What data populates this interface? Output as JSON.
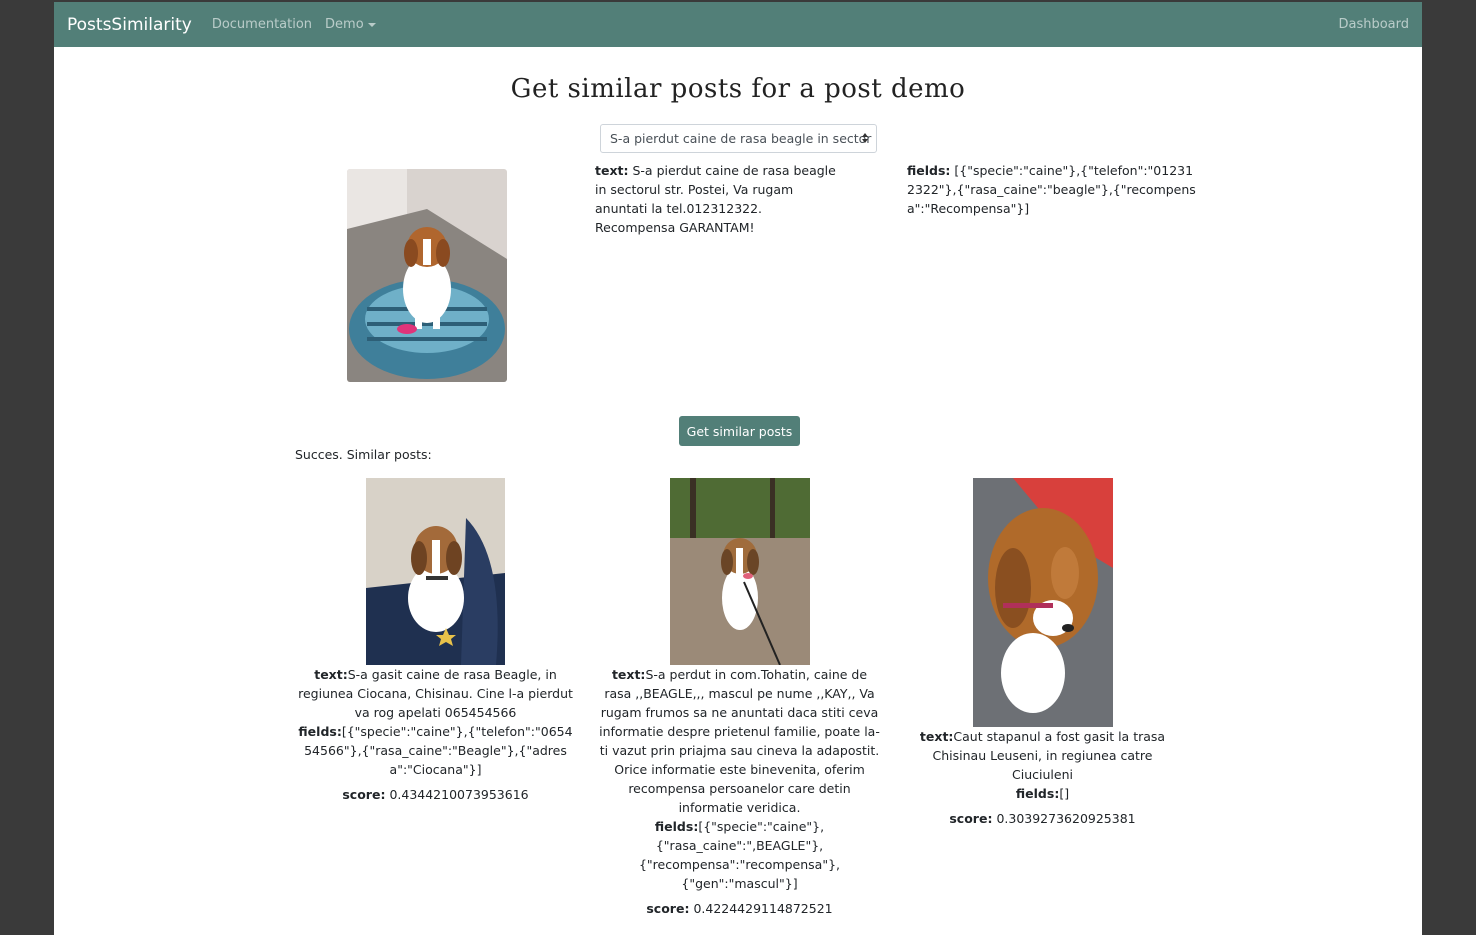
{
  "navbar": {
    "brand": "PostsSimilarity",
    "links": [
      "Documentation",
      "Demo"
    ],
    "right_link": "Dashboard"
  },
  "title": "Get similar posts for a post demo",
  "select": {
    "value": "S-a pierdut caine de rasa beagle in sector"
  },
  "query_post": {
    "text_label": "text:",
    "text": "S-a pierdut caine de rasa beagle in sectorul str. Postei, Va rugam anuntati la tel.012312322. Recompensa GARANTAM!",
    "fields_label": "fields:",
    "fields": "[{\"specie\":\"caine\"},{\"telefon\":\"012312322\"},{\"rasa_caine\":\"beagle\"},{\"recompensa\":\"Recompensa\"}]"
  },
  "button": "Get similar posts",
  "status": "Succes. Similar posts:",
  "results": [
    {
      "text_label": "text:",
      "text": "S-a gasit caine de rasa Beagle, in regiunea Ciocana, Chisinau. Cine l-a pierdut va rog apelati 065454566",
      "fields_label": "fields:",
      "fields": "[{\"specie\":\"caine\"},{\"telefon\":\"065454566\"},{\"rasa_caine\":\"Beagle\"},{\"adresa\":\"Ciocana\"}]",
      "score_label": "score:",
      "score": "0.4344210073953616"
    },
    {
      "text_label": "text:",
      "text": "S-a perdut in com.Tohatin, caine de rasa ,,BEAGLE,,, mascul pe nume ,,KAY,, Va rugam frumos sa ne anuntati daca stiti ceva informatie despre prietenul familie, poate la-ti vazut prin priajma sau cineva la adapostit. Orice informatie este binevenita, oferim recompensa persoanelor care detin informatie veridica.",
      "fields_label": "fields:",
      "fields": "[{\"specie\":\"caine\"},{\"rasa_caine\":\",BEAGLE\"},{\"recompensa\":\"recompensa\"},{\"gen\":\"mascul\"}]",
      "score_label": "score:",
      "score": "0.4224429114872521"
    },
    {
      "text_label": "text:",
      "text": "Caut stapanul a fost gasit la trasa Chisinau Leuseni, in regiunea catre Ciuciuleni",
      "fields_label": "fields:",
      "fields": "[]",
      "score_label": "score:",
      "score": "0.3039273620925381"
    }
  ],
  "colors": {
    "navbar": "#527f78",
    "button": "#527f78",
    "background_outer": "#3a3a3a"
  },
  "icons": [
    "beagle-photo-query",
    "beagle-photo-result-1",
    "beagle-photo-result-2",
    "beagle-photo-result-3",
    "caret-down-icon",
    "select-arrows-icon"
  ]
}
